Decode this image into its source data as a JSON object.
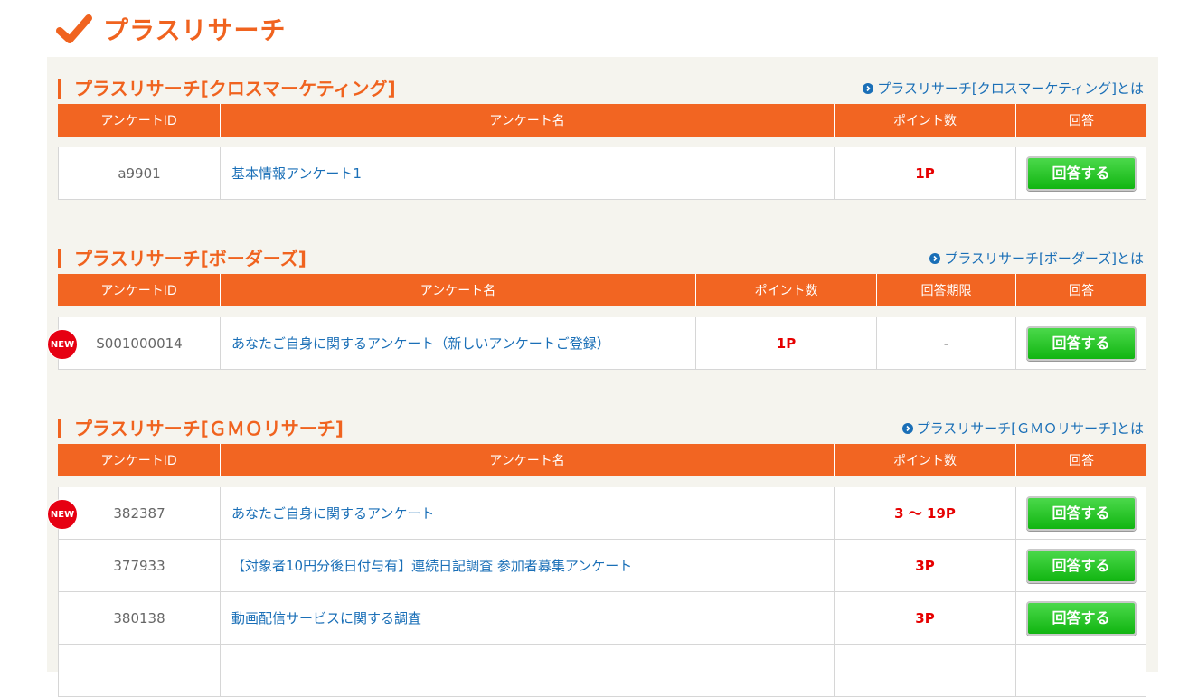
{
  "page": {
    "title": "プラスリサーチ"
  },
  "sections": [
    {
      "title": "プラスリサーチ[クロスマーケティング]",
      "link": "プラスリサーチ[クロスマーケティング]とは",
      "headers": [
        "アンケートID",
        "アンケート名",
        "ポイント数",
        "回答"
      ],
      "rows": [
        {
          "id": "a9901",
          "name": "基本情報アンケート1",
          "points": "1P",
          "button": "回答する"
        }
      ]
    },
    {
      "title": "プラスリサーチ[ボーダーズ]",
      "link": "プラスリサーチ[ボーダーズ]とは",
      "headers": [
        "アンケートID",
        "アンケート名",
        "ポイント数",
        "回答期限",
        "回答"
      ],
      "rows": [
        {
          "new": "NEW",
          "id": "S001000014",
          "name": "あなたご自身に関するアンケート（新しいアンケートご登録）",
          "points": "1P",
          "deadline": "-",
          "button": "回答する"
        }
      ]
    },
    {
      "title": "プラスリサーチ[ＧＭＯリサーチ]",
      "link": "プラスリサーチ[ＧＭＯリサーチ]とは",
      "headers": [
        "アンケートID",
        "アンケート名",
        "ポイント数",
        "回答"
      ],
      "rows": [
        {
          "new": "NEW",
          "id": "382387",
          "name": "あなたご自身に関するアンケート",
          "points": "3 ～ 19P",
          "button": "回答する"
        },
        {
          "id": "377933",
          "name": "【対象者10円分後日付与有】連続日記調査 参加者募集アンケート",
          "points": "3P",
          "button": "回答する"
        },
        {
          "id": "380138",
          "name": "動画配信サービスに関する調査",
          "points": "3P",
          "button": "回答する"
        }
      ]
    }
  ],
  "icons": {
    "header": "checkmark-icon",
    "link": "circle-arrow-icon"
  },
  "colors": {
    "accent": "#f26522",
    "points": "#e60000",
    "button": "#19c019",
    "link": "#1a6fb7",
    "new": "#e60012"
  }
}
